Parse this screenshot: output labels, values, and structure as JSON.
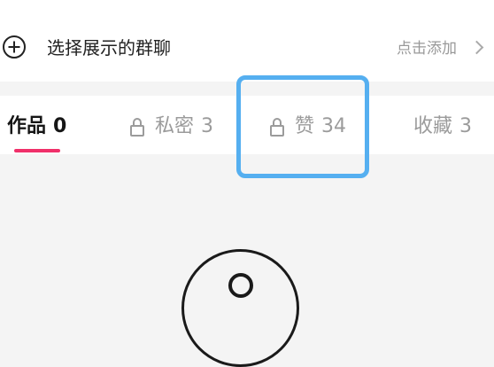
{
  "group_section": {
    "label": "选择展示的群聊",
    "action": "点击添加",
    "plus_icon": "plus-circle-icon",
    "chevron_icon": "chevron-right-icon"
  },
  "tabs": [
    {
      "label": "作品",
      "count": "0",
      "locked": false,
      "active": true
    },
    {
      "label": "私密",
      "count": "3",
      "locked": true,
      "active": false
    },
    {
      "label": "赞",
      "count": "34",
      "locked": true,
      "active": false
    },
    {
      "label": "收藏",
      "count": "3",
      "locked": false,
      "active": false
    }
  ],
  "colors": {
    "active_indicator": "#f0306a",
    "highlight_border": "#55aff0",
    "inactive_text": "#9b9b9b"
  }
}
